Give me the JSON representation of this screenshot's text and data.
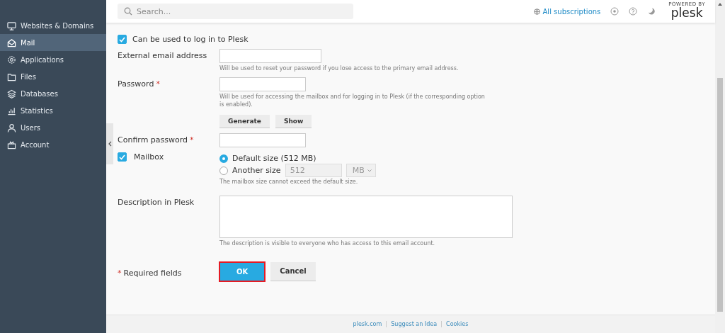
{
  "sidebar": {
    "items": [
      {
        "label": "Websites & Domains",
        "selected": false
      },
      {
        "label": "Mail",
        "selected": true
      },
      {
        "label": "Applications",
        "selected": false
      },
      {
        "label": "Files",
        "selected": false
      },
      {
        "label": "Databases",
        "selected": false
      },
      {
        "label": "Statistics",
        "selected": false
      },
      {
        "label": "Users",
        "selected": false
      },
      {
        "label": "Account",
        "selected": false
      }
    ]
  },
  "header": {
    "search": {
      "placeholder": "Search..."
    },
    "subscriptions_link": "All subscriptions",
    "logo": {
      "tagline": "POWERED BY",
      "name": "plesk"
    }
  },
  "form": {
    "login_checkbox": {
      "label": "Can be used to log in to Plesk",
      "checked": true
    },
    "external_email": {
      "label": "External email address",
      "hint": "Will be used to reset your password if you lose access to the primary email address."
    },
    "password": {
      "label": "Password",
      "required_mark": "*",
      "hint": "Will be used for accessing the mailbox and for logging in to Plesk (if the corresponding option is enabled).",
      "buttons": [
        "Generate",
        "Show"
      ]
    },
    "confirm_password": {
      "label": "Confirm password",
      "required_mark": "*"
    },
    "mailbox": {
      "label": "Mailbox",
      "checked": true,
      "options": [
        {
          "label": "Default size (512 MB)",
          "selected": true
        },
        {
          "label": "Another size",
          "selected": false,
          "size_value": "512",
          "unit": "MB"
        }
      ],
      "hint": "The mailbox size cannot exceed the default size."
    },
    "description": {
      "label": "Description in Plesk",
      "hint": "The description is visible to everyone who has access to this email account."
    },
    "required_note": {
      "mark": "*",
      "text": "Required fields"
    },
    "buttons": [
      {
        "label": "OK",
        "kind": "primary"
      },
      {
        "label": "Cancel",
        "kind": "secondary"
      }
    ]
  },
  "footer": {
    "links": [
      "plesk.com",
      "Suggest an Idea",
      "Cookies"
    ]
  }
}
